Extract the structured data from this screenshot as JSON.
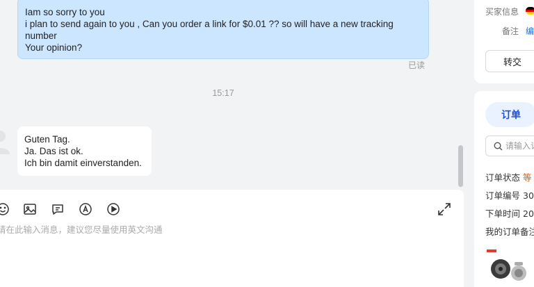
{
  "chat": {
    "outgoing": {
      "lines": [
        "Iam so sorry to you",
        "i plan to send again to you , Can you order a link for $0.01 ?? so will have a new tracking",
        "number",
        "Your opinion?"
      ],
      "read_status": "已读"
    },
    "timestamp": "15:17",
    "incoming": {
      "lines": [
        "Guten Tag.",
        "Ja. Das ist ok.",
        "Ich bin damit einverstanden."
      ]
    }
  },
  "composer": {
    "placeholder": "请在此输入消息，建议您尽量使用英文沟通",
    "tools": [
      "emoji-icon",
      "image-icon",
      "quick-reply-icon",
      "translate-icon",
      "video-icon"
    ]
  },
  "buyer_panel": {
    "buyer_info_label": "买家信息",
    "flag": "germany",
    "note_label": "备注",
    "note_action": "编",
    "transfer_button": "转交"
  },
  "order_panel": {
    "tab_label": "订单",
    "search_placeholder": "请输入订",
    "status_label": "订单状态",
    "status_value": "等",
    "order_no_label": "订单编号",
    "order_no_value": "30",
    "order_time_label": "下单时间",
    "order_time_value": "20",
    "my_note_label": "我的订单备注"
  },
  "colors": {
    "outgoing_bubble": "#cde6ff",
    "accent": "#1d4ed8",
    "status_orange": "#e8590c"
  }
}
